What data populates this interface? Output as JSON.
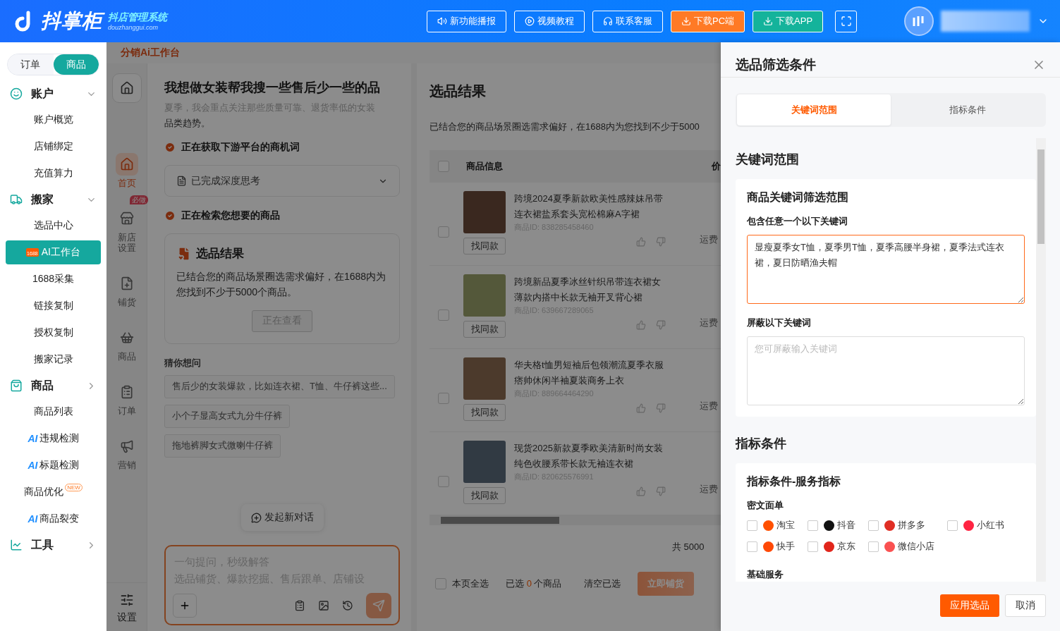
{
  "header": {
    "logo_title": "抖掌柜",
    "logo_subtitle": "抖店管理系统",
    "logo_url": "douzhanggui.com",
    "buttons": [
      {
        "label": "新功能播报",
        "kind": "outline"
      },
      {
        "label": "视频教程",
        "kind": "outline"
      },
      {
        "label": "联系客服",
        "kind": "outline"
      },
      {
        "label": "下载PC端",
        "kind": "orange"
      },
      {
        "label": "下载APP",
        "kind": "teal"
      }
    ]
  },
  "sidebar": {
    "tabs": [
      {
        "label": "订单",
        "selected": false
      },
      {
        "label": "商品",
        "selected": true
      }
    ],
    "groups": [
      {
        "label": "账户",
        "expanded": true,
        "items": [
          {
            "label": "账户概览",
            "selected": false
          },
          {
            "label": "店铺绑定",
            "selected": false
          },
          {
            "label": "充值算力",
            "selected": false
          }
        ]
      },
      {
        "label": "搬家",
        "expanded": true,
        "items": [
          {
            "label": "选品中心",
            "selected": false
          },
          {
            "label": "AI工作台",
            "selected": true,
            "logo": "1688"
          },
          {
            "label": "1688采集",
            "selected": false
          },
          {
            "label": "链接复制",
            "selected": false
          },
          {
            "label": "授权复制",
            "selected": false
          },
          {
            "label": "搬家记录",
            "selected": false
          }
        ]
      },
      {
        "label": "商品",
        "expanded": false,
        "items": [
          {
            "label": "商品列表",
            "selected": false
          },
          {
            "label": "违规检测",
            "selected": false,
            "prefix": "AI"
          },
          {
            "label": "标题检测",
            "selected": false,
            "prefix": "AI"
          },
          {
            "label": "商品优化",
            "selected": false,
            "badge": "NEW"
          },
          {
            "label": "商品裂变",
            "selected": false,
            "prefix": "AI"
          }
        ]
      },
      {
        "label": "工具",
        "expanded": false
      }
    ]
  },
  "workspace": {
    "title": "分销Ai工作台",
    "rail": [
      {
        "label": "首页",
        "selected": true
      },
      {
        "label": "新店设置",
        "selected": false,
        "badge": "必做"
      },
      {
        "label": "铺货",
        "selected": false
      },
      {
        "label": "商品",
        "selected": false
      },
      {
        "label": "订单",
        "selected": false
      },
      {
        "label": "营销",
        "selected": false
      }
    ],
    "rail_bottom": "设置",
    "chat": {
      "question": "我想做女装帮我搜一些售后少一些的品",
      "faded_line": "夏季，我会重点关注那些质量可靠、退货率低的女装",
      "answer_tail": "品类趋势。",
      "steps": [
        {
          "label": "正在获取下游平台的商机词",
          "done": true
        },
        {
          "label": "正在检索您想要的商品",
          "done": true
        }
      ],
      "thinking": {
        "label": "已完成深度思考",
        "expanded": false
      },
      "result_card": {
        "title": "选品结果",
        "text": "已结合您的商品场景圈选需求偏好，在1688内为您找到不少于5000个商品。",
        "button": "正在查看"
      },
      "suggest_title": "猜你想问",
      "suggestions": [
        "售后少的女装爆款，比如连衣裙、T恤、牛仔裤这些...",
        "小个子显高女式九分牛仔裤",
        "拖地裤脚女式微喇牛仔裤"
      ],
      "new_chat": "发起新对话",
      "input": {
        "placeholder_lines": [
          "一句提问，秒级解答",
          "选品铺货、爆款挖掘、售后跟单、店铺设"
        ]
      }
    },
    "results": {
      "title": "选品结果",
      "summary": "已结合您的商品场景圈选需求偏好，在1688内为您找到不少于5000",
      "columns": [
        "商品信息",
        "价"
      ],
      "all_checked": false,
      "rows": [
        {
          "title": "跨境2024夏季新款欧美性感辣妹吊带连衣裙盐系套头宽松棉麻A字裙",
          "id": "商品ID: 838285458460",
          "find": "找同款",
          "shipping": "运费",
          "checked": false
        },
        {
          "title": "跨境新品夏季冰丝针织吊带连衣裙女薄款内搭中长款无袖开叉背心裙",
          "id": "商品ID: 639667289065",
          "find": "找同款",
          "shipping": "运费",
          "checked": false
        },
        {
          "title": "华夫格t恤男短袖后包领潮流夏季衣服痞帅休闲半袖夏装商务上衣",
          "id": "商品ID: 889664464290",
          "find": "找同款",
          "shipping": "运费",
          "checked": false
        },
        {
          "title": "现货2025新款夏季欧美清新时尚女装纯色收腰系带长款无袖连衣裙",
          "id": "商品ID: 820625576991",
          "find": "找同款",
          "shipping": "运费",
          "checked": false
        }
      ],
      "total": "共 5000",
      "footer": {
        "select_all": "本页全选",
        "select_all_checked": false,
        "selected_prefix": "已选",
        "selected_count": "0",
        "selected_suffix": "个商品",
        "clear": "清空已选",
        "submit": "立即铺货"
      }
    }
  },
  "drawer": {
    "title": "选品筛选条件",
    "tabs": [
      {
        "label": "关键词范围",
        "selected": true
      },
      {
        "label": "指标条件",
        "selected": false
      }
    ],
    "keyword_section": {
      "title": "关键词范围",
      "card_title": "商品关键词筛选范围",
      "include_label": "包含任意一个以下关键词",
      "include_value": "显瘦夏季女T恤，夏季男T恤，夏季高腰半身裙，夏季法式连衣裙，夏日防晒渔夫帽",
      "exclude_label": "屏蔽以下关键词",
      "exclude_placeholder": "您可屏蔽输入关键词"
    },
    "metric_section": {
      "title": "指标条件",
      "card_title": "指标条件-服务指标",
      "group_label": "密文面单",
      "platforms": [
        {
          "label": "淘宝",
          "checked": false,
          "color": "#ff5000"
        },
        {
          "label": "抖音",
          "checked": false,
          "color": "#111111"
        },
        {
          "label": "拼多多",
          "checked": false,
          "color": "#e02e24"
        },
        {
          "label": "小红书",
          "checked": false,
          "color": "#ff2442"
        },
        {
          "label": "快手",
          "checked": false,
          "color": "#ff4906"
        },
        {
          "label": "京东",
          "checked": false,
          "color": "#e1251b"
        },
        {
          "label": "微信小店",
          "checked": false,
          "color": "#fa5151"
        }
      ],
      "next_label": "基础服务"
    },
    "buttons": [
      {
        "label": "应用选品",
        "kind": "primary"
      },
      {
        "label": "取消",
        "kind": "plain"
      }
    ]
  }
}
